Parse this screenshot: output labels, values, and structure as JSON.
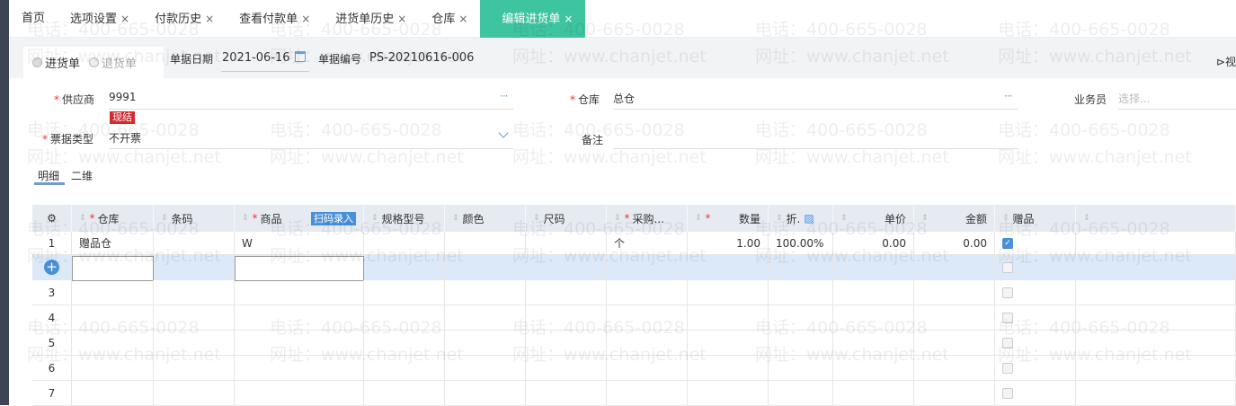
{
  "tabs": [
    {
      "label": "首页",
      "closable": false
    },
    {
      "label": "选项设置",
      "closable": true
    },
    {
      "label": "付款历史",
      "closable": true
    },
    {
      "label": "查看付款单",
      "closable": true
    },
    {
      "label": "进货单历史",
      "closable": true
    },
    {
      "label": "仓库",
      "closable": true
    },
    {
      "label": "编辑进货单",
      "closable": true,
      "active": true
    }
  ],
  "close_glyph": "×",
  "toolbar": {
    "radio_purchase": "进货单",
    "radio_return": "退货单",
    "date_label": "单据日期",
    "date_value": "2021-06-16",
    "number_label": "单据编号",
    "number_value": "PS-20210616-006",
    "video_label": "视"
  },
  "form": {
    "supplier_label": "供应商",
    "supplier_value": "9991",
    "settle_badge": "现结",
    "invoice_label": "票据类型",
    "invoice_value": "不开票",
    "warehouse_label": "仓库",
    "warehouse_value": "总仓",
    "remark_label": "备注",
    "salesman_label": "业务员",
    "salesman_placeholder": "选择...",
    "more": "···",
    "required": "*"
  },
  "subtabs": [
    "明细",
    "二维"
  ],
  "table": {
    "scan_label": "扫码录入",
    "headers": [
      "仓库",
      "条码",
      "商品",
      "规格型号",
      "颜色",
      "尺码",
      "采购...",
      "数量",
      "折.",
      "单价",
      "金额",
      "赠品",
      ""
    ],
    "required_cols": [
      0,
      2,
      6,
      7
    ],
    "rows": [
      {
        "no": "1",
        "warehouse": "赠品仓",
        "product": "W",
        "unit": "个",
        "qty": "1.00",
        "discount": "100.00%",
        "price": "0.00",
        "amount": "0.00",
        "gift": true
      },
      {
        "no": "",
        "gift": false,
        "editing": true
      },
      {
        "no": "3",
        "gift": false
      },
      {
        "no": "4",
        "gift": false
      },
      {
        "no": "5",
        "gift": false
      },
      {
        "no": "6",
        "gift": false
      },
      {
        "no": "7",
        "gift": false
      }
    ]
  },
  "watermark": {
    "phone": "电话：400-665-0028",
    "site": "网址：www.chanjet.net"
  },
  "colors": {
    "accent": "#3fc4a0",
    "blue": "#4a90d9",
    "selected_row": "#dce9f8"
  }
}
